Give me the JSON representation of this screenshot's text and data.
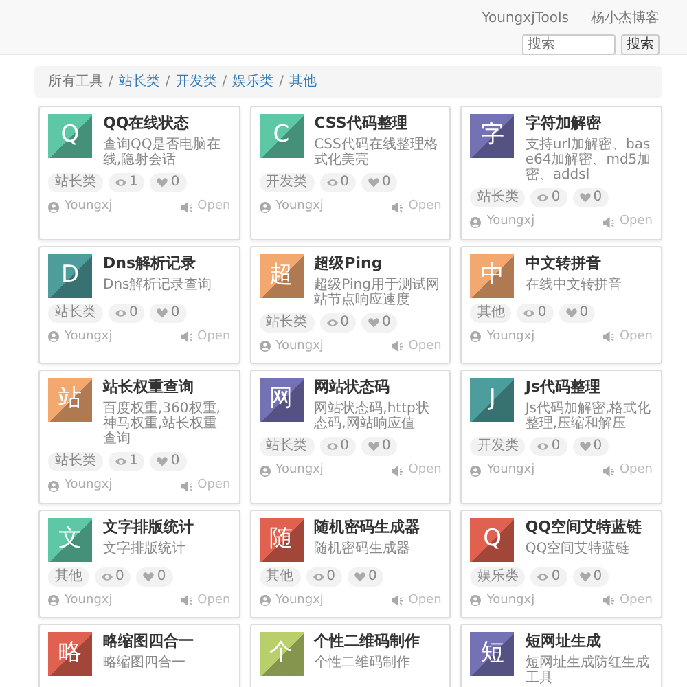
{
  "navbar": {
    "links": [
      "YoungxjTools",
      "杨小杰博客"
    ],
    "search": {
      "placeholder": "搜索",
      "button": "搜索"
    }
  },
  "breadcrumb": {
    "separator": "/",
    "items": [
      "所有工具",
      "站长类",
      "开发类",
      "娱乐类",
      "其他"
    ]
  },
  "tools": [
    {
      "letter": "Q",
      "color": "#5ec8a6",
      "title": "QQ在线状态",
      "description": "查询QQ是否电脑在线,隐射会话",
      "category": "站长类",
      "views": "1",
      "likes": "0",
      "author": "Youngxj",
      "action": "Open"
    },
    {
      "letter": "C",
      "color": "#5ec8a6",
      "title": "CSS代码整理",
      "description": "CSS代码在线整理格式化美亮",
      "category": "开发类",
      "views": "0",
      "likes": "0",
      "author": "Youngxj",
      "action": "Open"
    },
    {
      "letter": "字",
      "color": "#7471b5",
      "title": "字符加解密",
      "description": "支持url加解密、base64加解密、md5加密、addsl",
      "category": "站长类",
      "views": "0",
      "likes": "0",
      "author": "Youngxj",
      "action": "Open"
    },
    {
      "letter": "D",
      "color": "#4c9d9c",
      "title": "Dns解析记录",
      "description": "Dns解析记录查询",
      "category": "站长类",
      "views": "0",
      "likes": "0",
      "author": "Youngxj",
      "action": "Open"
    },
    {
      "letter": "超",
      "color": "#f3a870",
      "title": "超级Ping",
      "description": "超级Ping用于测试网站节点响应速度",
      "category": "站长类",
      "views": "0",
      "likes": "0",
      "author": "Youngxj",
      "action": "Open"
    },
    {
      "letter": "中",
      "color": "#f3a870",
      "title": "中文转拼音",
      "description": "在线中文转拼音",
      "category": "其他",
      "views": "0",
      "likes": "0",
      "author": "Youngxj",
      "action": "Open"
    },
    {
      "letter": "站",
      "color": "#f3a870",
      "title": "站长权重查询",
      "description": "百度权重,360权重,神马权重,站长权重查询",
      "category": "站长类",
      "views": "1",
      "likes": "0",
      "author": "Youngxj",
      "action": "Open"
    },
    {
      "letter": "网",
      "color": "#7471b5",
      "title": "网站状态码",
      "description": "网站状态码,http状态码,网站响应值",
      "category": "站长类",
      "views": "0",
      "likes": "0",
      "author": "Youngxj",
      "action": "Open"
    },
    {
      "letter": "J",
      "color": "#4c9d9c",
      "title": "Js代码整理",
      "description": "Js代码加解密,格式化整理,压缩和解压",
      "category": "开发类",
      "views": "0",
      "likes": "0",
      "author": "Youngxj",
      "action": "Open"
    },
    {
      "letter": "文",
      "color": "#5ec8a6",
      "title": "文字排版统计",
      "description": "文字排版统计",
      "category": "其他",
      "views": "0",
      "likes": "0",
      "author": "Youngxj",
      "action": "Open"
    },
    {
      "letter": "随",
      "color": "#e0614f",
      "title": "随机密码生成器",
      "description": "随机密码生成器",
      "category": "其他",
      "views": "0",
      "likes": "0",
      "author": "Youngxj",
      "action": "Open"
    },
    {
      "letter": "Q",
      "color": "#e0614f",
      "title": "QQ空间艾特蓝链",
      "description": "QQ空间艾特蓝链",
      "category": "娱乐类",
      "views": "0",
      "likes": "0",
      "author": "Youngxj",
      "action": "Open"
    },
    {
      "letter": "略",
      "color": "#e0614f",
      "title": "略缩图四合一",
      "description": "略缩图四合一"
    },
    {
      "letter": "个",
      "color": "#b8cf6c",
      "title": "个性二维码制作",
      "description": "个性二维码制作"
    },
    {
      "letter": "短",
      "color": "#7471b5",
      "title": "短网址生成",
      "description": "短网址生成防红生成工具"
    }
  ]
}
